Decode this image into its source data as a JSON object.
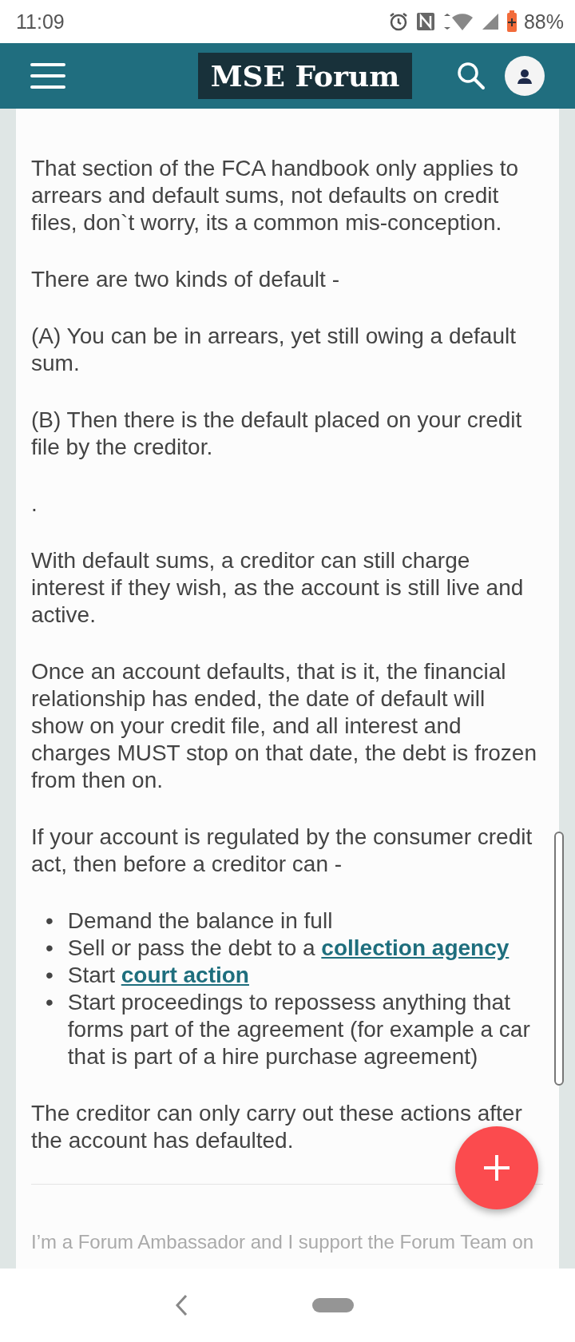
{
  "status_bar": {
    "time": "11:09",
    "battery": "88%"
  },
  "header": {
    "title": "MSE Forum"
  },
  "post": {
    "blocks": [
      {
        "kind": "paragraph",
        "text": "That section of the FCA handbook only applies to arrears and default sums, not defaults on credit files, don`t worry, its a common mis-conception."
      },
      {
        "kind": "paragraph",
        "text": "There are two kinds of default -"
      },
      {
        "kind": "paragraph",
        "text": "(A) You can be in arrears, yet still owing a default sum."
      },
      {
        "kind": "paragraph",
        "text": "(B) Then there is the default placed on your credit file by the creditor."
      },
      {
        "kind": "paragraph",
        "text": "."
      },
      {
        "kind": "paragraph",
        "text": "With default sums, a creditor can still charge interest if they wish, as the account is still live and active."
      },
      {
        "kind": "paragraph",
        "text": "Once an account defaults, that is it, the financial relationship has ended, the date of default will show on your credit file, and all interest and charges MUST stop on that date, the debt is frozen from then on."
      },
      {
        "kind": "paragraph",
        "text": "If your account is regulated by the consumer credit act, then before a creditor can -"
      },
      {
        "kind": "list",
        "items": [
          {
            "bullet": "•",
            "parts": [
              {
                "kind": "text",
                "text": "Demand the balance in full"
              }
            ]
          },
          {
            "bullet": "•",
            "parts": [
              {
                "kind": "text",
                "text": "Sell or pass the debt to a "
              },
              {
                "kind": "link",
                "text": "collection agency"
              }
            ]
          },
          {
            "bullet": "•",
            "parts": [
              {
                "kind": "text",
                "text": "Start "
              },
              {
                "kind": "link",
                "text": "court action"
              }
            ]
          },
          {
            "bullet": "•",
            "parts": [
              {
                "kind": "text",
                "text": "Start proceedings to repossess anything that forms part of the agreement (for example a car that is part of a hire purchase agreement)"
              }
            ]
          }
        ]
      },
      {
        "kind": "paragraph",
        "text": "The creditor can only carry out these actions after the account has defaulted."
      }
    ],
    "signature": "I’m a Forum Ambassador and I support the Forum Team on"
  }
}
